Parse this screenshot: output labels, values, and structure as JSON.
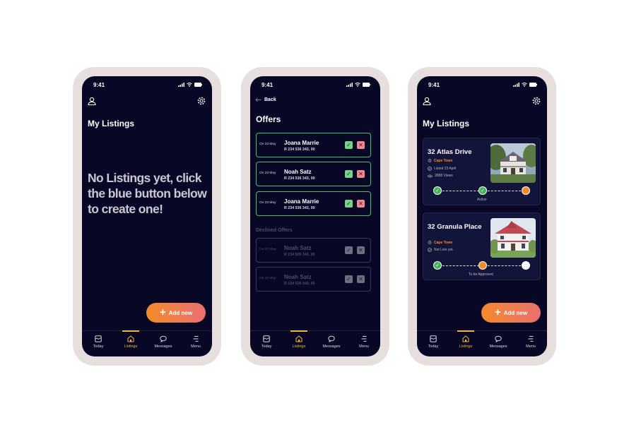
{
  "status_time": "9:41",
  "phones": {
    "empty": {
      "title": "My Listings",
      "empty_message": "No Listings yet, click the blue button below to create one!",
      "add_button": "Add new"
    },
    "offers": {
      "back_label": "Back",
      "title": "Offers",
      "offers": [
        {
          "date": "On 23 May",
          "name": "Joana Marrie",
          "amount": "R 234 536 343, 00"
        },
        {
          "date": "On 23 May",
          "name": "Noah Satz",
          "amount": "R 234 536 343, 00"
        },
        {
          "date": "On 23 May",
          "name": "Joana Marrie",
          "amount": "R 234 536 343, 00"
        }
      ],
      "declined_heading": "Declined Offers",
      "declined": [
        {
          "date": "On 23 May",
          "name": "Noah Satz",
          "amount": "R 234 536 343, 00"
        },
        {
          "date": "On 23 May",
          "name": "Noah Satz",
          "amount": "R 234 536 343, 00"
        }
      ]
    },
    "listings": {
      "title": "My Listings",
      "add_button": "Add new",
      "cards": [
        {
          "address": "32 Atlas Drive",
          "city": "Cape Town",
          "listed": "Listed 23 April",
          "views": "2888 Views",
          "stage_label": "Active"
        },
        {
          "address": "32 Granula Place",
          "city": "Cape Town",
          "listed": "Not Live yet.",
          "stage_label": "To be Approved"
        }
      ]
    }
  },
  "tabs": [
    {
      "label": "Today",
      "icon": "today-icon"
    },
    {
      "label": "Listings",
      "icon": "home-icon"
    },
    {
      "label": "Messages",
      "icon": "chat-icon"
    },
    {
      "label": "Menu",
      "icon": "menu-icon"
    }
  ],
  "colors": {
    "screen_bg": "#080726",
    "accent_orange": "#f58a2a",
    "active_tab": "#f0b838",
    "accept_green": "#41c46a",
    "decline_pink": "#ee8a93"
  }
}
